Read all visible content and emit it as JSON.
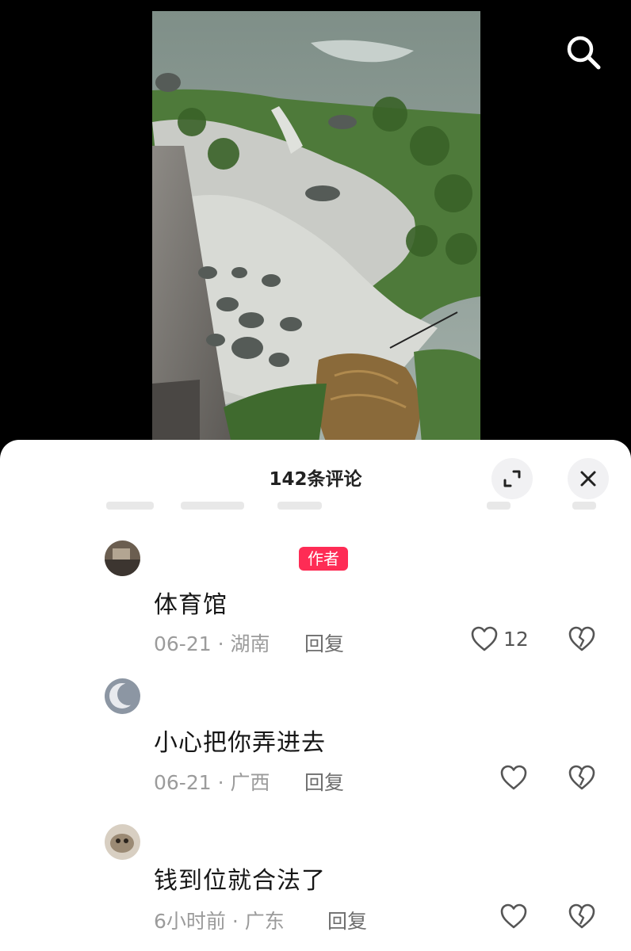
{
  "header": {
    "title": "142条评论"
  },
  "comments": [
    {
      "badge": "作者",
      "text": "体育馆",
      "meta": "06-21 · 湖南",
      "reply": "回复",
      "likes": "12"
    },
    {
      "text": "小心把你弄进去",
      "meta": "06-21 · 广西",
      "reply": "回复",
      "likes": ""
    },
    {
      "text": "钱到位就合法了",
      "meta": "6小时前 · 广东",
      "reply": "回复",
      "likes": ""
    }
  ],
  "icons": {
    "search": "search-icon",
    "expand": "expand-icon",
    "close": "close-icon",
    "like": "heart-icon",
    "dislike": "broken-heart-icon"
  },
  "colors": {
    "author_badge": "#fe2c55",
    "sheet_bg": "#ffffff",
    "meta_text": "#9b9b9b"
  }
}
